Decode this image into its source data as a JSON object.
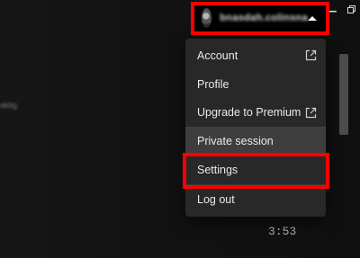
{
  "window": {
    "minimize_icon": "minimize-icon",
    "restore_icon": "restore-icon"
  },
  "user": {
    "name": "bnasdah.colinsna",
    "avatar_icon": "avatar"
  },
  "background": {
    "blurred_label": "aktig",
    "track_duration": "3:53"
  },
  "menu": {
    "items": [
      {
        "label": "Account",
        "icon": "external-link-icon"
      },
      {
        "label": "Profile"
      },
      {
        "label": "Upgrade to Premium",
        "icon": "external-link-icon"
      },
      {
        "label": "Private session",
        "active": true
      },
      {
        "label": "Settings"
      },
      {
        "label": "Log out"
      }
    ]
  },
  "colors": {
    "highlight": "#ff0000",
    "menu_bg": "#282828",
    "app_bg": "#121212"
  }
}
